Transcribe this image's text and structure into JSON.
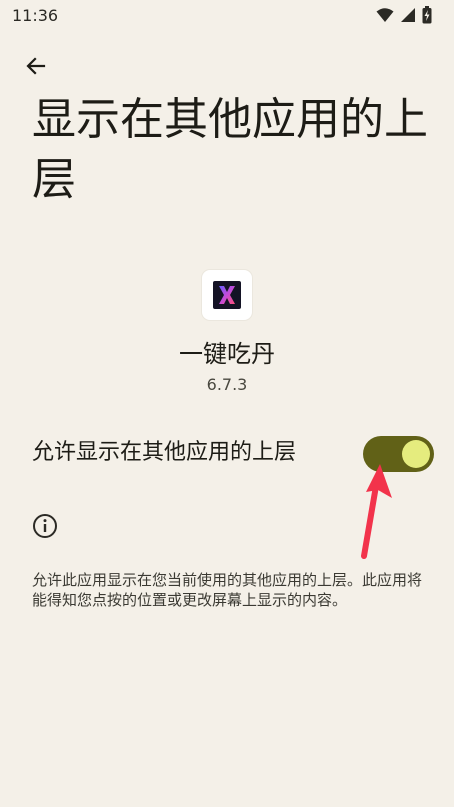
{
  "status_bar": {
    "time": "11:36",
    "icons": [
      "wifi-icon",
      "signal-icon",
      "battery-charging-icon"
    ]
  },
  "header": {
    "back_icon": "arrow-left-icon",
    "title": "显示在其他应用的上层"
  },
  "app": {
    "icon": "app-x-logo-icon",
    "name": "一键吃丹",
    "version": "6.7.3"
  },
  "permission": {
    "label": "允许显示在其他应用的上层",
    "enabled": true
  },
  "info": {
    "icon": "info-icon",
    "text": "允许此应用显示在您当前使用的其他应用的上层。此应用将能得知您点按的位置或更改屏幕上显示的内容。"
  },
  "colors": {
    "background": "#f4f0e8",
    "toggle_track": "#616117",
    "toggle_thumb": "#e5ec7e",
    "annotation_arrow": "#f2334b"
  }
}
